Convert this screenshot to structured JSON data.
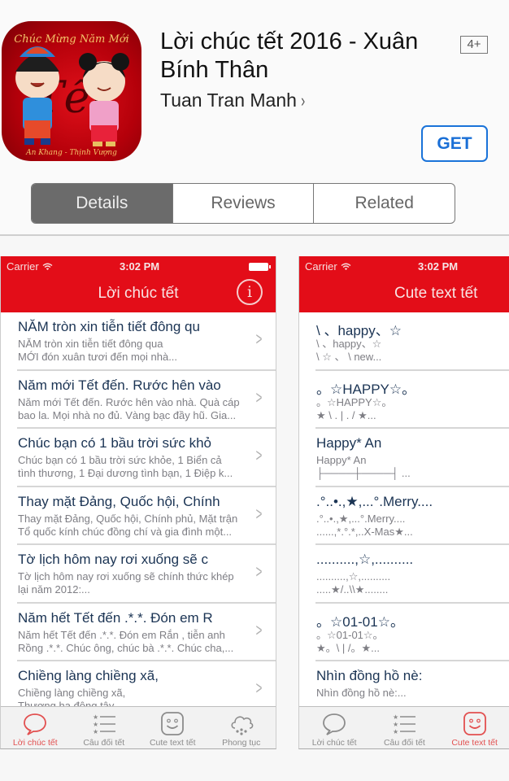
{
  "app": {
    "title": "Lời chúc tết 2016 - Xuân Bính Thân",
    "developer": "Tuan Tran Manh",
    "developer_chevron": "›",
    "age_rating": "4+",
    "get_label": "GET",
    "icon_text_top": "Chúc Mừng Năm Mới",
    "icon_text_center": "Tết",
    "icon_text_bottom": "An Khang - Thịnh Vượng"
  },
  "segments": [
    {
      "label": "Details",
      "active": true
    },
    {
      "label": "Reviews",
      "active": false
    },
    {
      "label": "Related",
      "active": false
    }
  ],
  "colors": {
    "nav_red": "#e30d18",
    "get_blue": "#1a6fd6",
    "tab_active": "#e25050",
    "row_title": "#1b3454"
  },
  "screenshot_left": {
    "status": {
      "carrier": "Carrier",
      "time": "3:02 PM"
    },
    "nav_title": "Lời chúc tết",
    "info_icon": "i",
    "rows": [
      {
        "title": "NĂM tròn xin tiễn tiết đông qu",
        "line1": "NĂM tròn xin tiễn tiết đông qua",
        "line2": "MỚI đón xuân tươi đến mọi nhà..."
      },
      {
        "title": "Năm mới Tết đến. Rước hên vào",
        "line1": "Năm mới Tết đến. Rước hên vào nhà. Quà cáp",
        "line2": "bao la. Mọi nhà no đủ. Vàng bạc đầy hũ. Gia..."
      },
      {
        "title": "Chúc bạn có 1 bầu trời sức khỏ",
        "line1": "Chúc bạn có 1 bầu trời sức khỏe, 1 Biển cả",
        "line2": "tình thương, 1 Đại dương tình bạn, 1 Điệp k..."
      },
      {
        "title": "Thay mặt Đảng, Quốc hội, Chính",
        "line1": "Thay mặt Đảng, Quốc hội, Chính phủ, Mặt trận",
        "line2": "Tổ quốc kính chúc đồng chí và gia đình một..."
      },
      {
        "title": "Tờ lịch hôm nay rơi xuống sẽ c",
        "line1": "Tờ lịch hôm nay rơi xuống sẽ chính thức khép",
        "line2": "lại năm 2012:..."
      },
      {
        "title": "Năm hết Tết đến .*.*. Đón em R",
        "line1": "Năm hết Tết đến .*.*. Đón em Rắn  , tiễn anh",
        "line2": "Rồng  .*.*. Chúc ông, chúc bà .*.*. Chúc cha,..."
      },
      {
        "title": "Chiềng làng chiềng xã,",
        "line1": "Chiềng làng chiềng xã,",
        "line2": "Thượng hạ đông tây"
      }
    ],
    "tabs": [
      {
        "label": "Lời chúc tết",
        "icon": "speech-bubble-icon",
        "active": true
      },
      {
        "label": "Câu đối tết",
        "icon": "star-list-icon",
        "active": false
      },
      {
        "label": "Cute text tết",
        "icon": "smiley-icon",
        "active": false
      },
      {
        "label": "Phong tục",
        "icon": "snow-cloud-icon",
        "active": false
      }
    ]
  },
  "screenshot_right": {
    "status": {
      "carrier": "Carrier",
      "time": "3:02 PM"
    },
    "nav_title": "Cute text tết",
    "rows": [
      {
        "title": "\\ 、happy、☆",
        "line1": "\\ 、happy、☆",
        "line2": "\\ ☆ 、 \\ new..."
      },
      {
        "title": "。☆HAPPY☆。",
        "line1": "。☆HAPPY☆。",
        "line2": "★   \\ . | . /    ★..."
      },
      {
        "title": "Happy* An",
        "line1": "Happy* An",
        "line2": "├────┼────┤ ..."
      },
      {
        "title": ".°..•.,★,...°.Merry....",
        "line1": ".°..•.,★,...°.Merry....",
        "line2": "......,*.°.*,..X-Mas★..."
      },
      {
        "title": "..........,☆,..........",
        "line1": "..........,☆,..........",
        "line2": ".....★/..\\\\★........"
      },
      {
        "title": "。☆01-01☆。",
        "line1": "。☆01-01☆。",
        "line2": "★。\\ | /。★..."
      },
      {
        "title": "Nhìn đồng hồ nè:",
        "line1": "Nhìn đồng hồ nè:...",
        "line2": ""
      }
    ],
    "tabs": [
      {
        "label": "Lời chúc tết",
        "icon": "speech-bubble-icon",
        "active": false
      },
      {
        "label": "Câu đối tết",
        "icon": "star-list-icon",
        "active": false
      },
      {
        "label": "Cute text tết",
        "icon": "smiley-icon",
        "active": true
      }
    ]
  }
}
